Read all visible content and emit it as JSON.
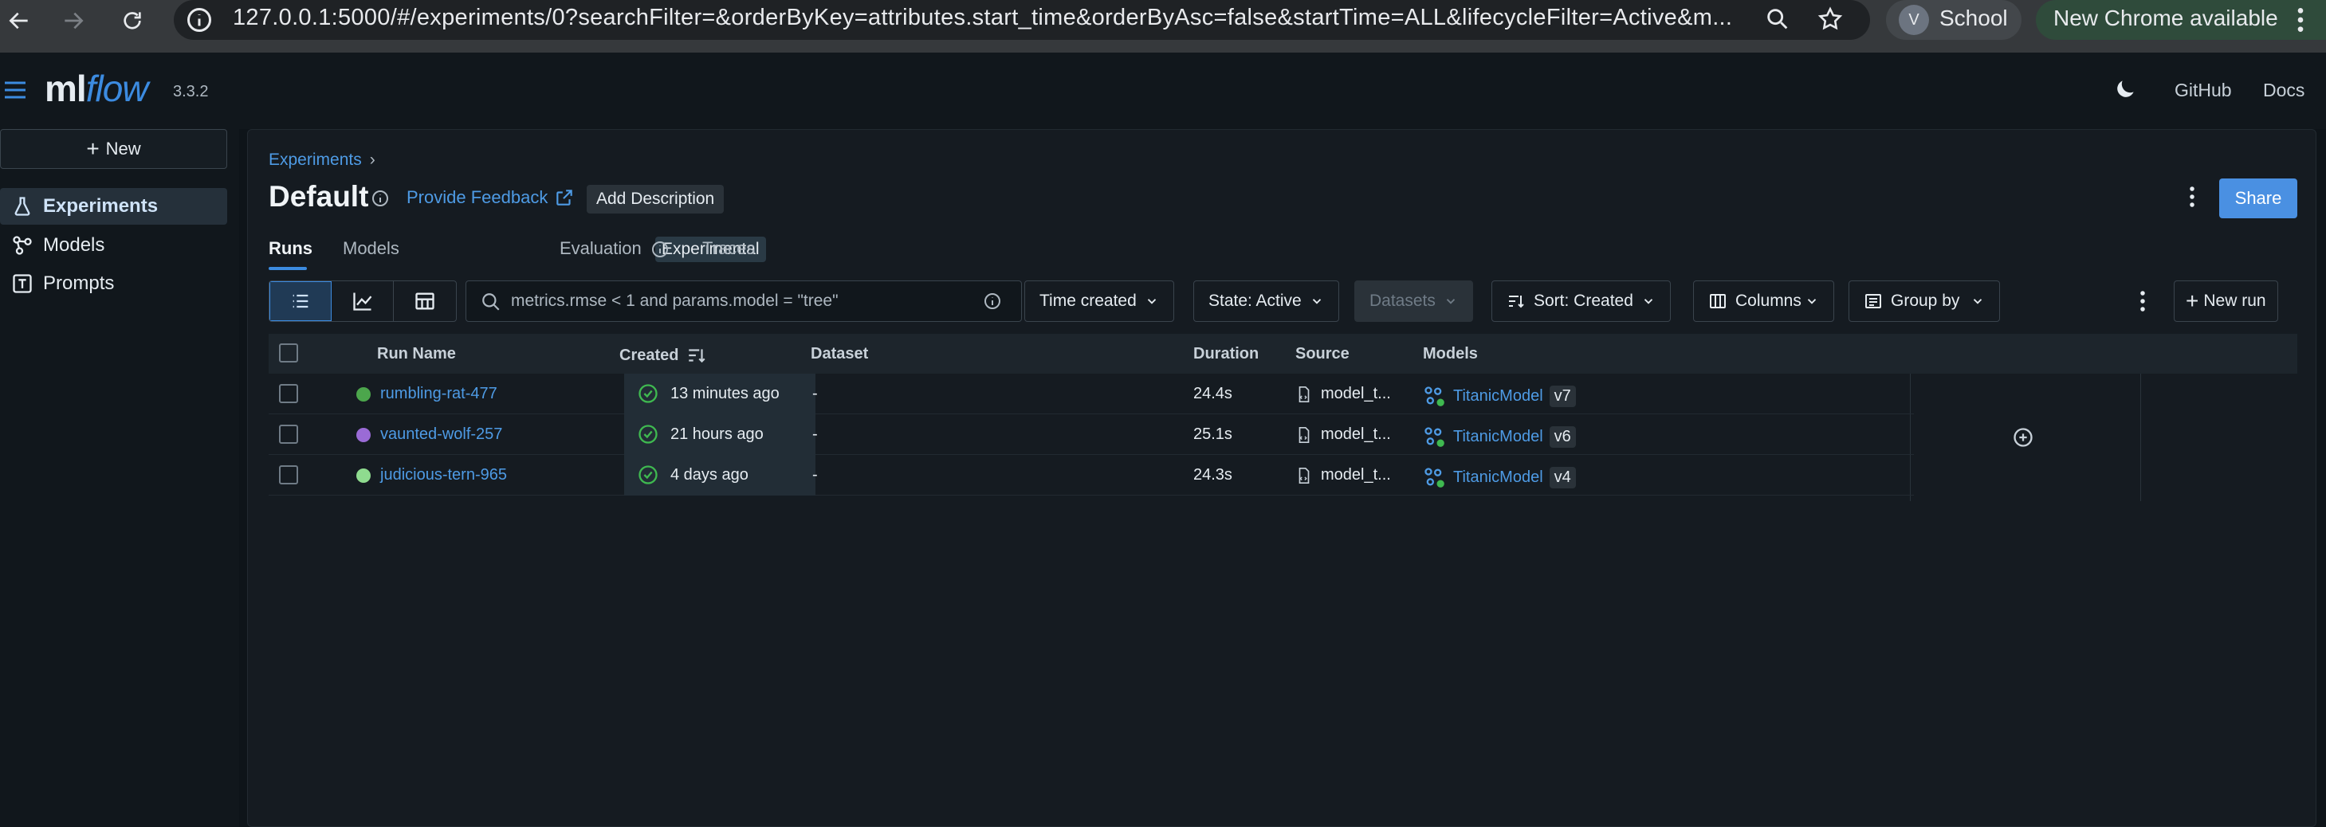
{
  "browser": {
    "url_main": "127.0.0.1:5000/#/experiments/0?searchFilter=&orderByKey=attributes.start_time&orderByAsc=false&startTime=ALL&lifecycleFilter=Active&m...",
    "profile_initial": "V",
    "profile_name": "School",
    "update_label": "New Chrome available"
  },
  "header": {
    "logo_ml": "ml",
    "logo_flow": "flow",
    "version": "3.3.2",
    "links": [
      "GitHub",
      "Docs"
    ]
  },
  "sidebar": {
    "new_label": "New",
    "items": [
      {
        "label": "Experiments",
        "icon": "beaker-icon",
        "active": true
      },
      {
        "label": "Models",
        "icon": "models-icon",
        "active": false
      },
      {
        "label": "Prompts",
        "icon": "prompts-icon",
        "active": false
      }
    ]
  },
  "page": {
    "breadcrumb": "Experiments",
    "title": "Default",
    "feedback_label": "Provide Feedback",
    "add_description_label": "Add Description",
    "share_label": "Share"
  },
  "tabs": [
    {
      "label": "Runs",
      "active": true
    },
    {
      "label": "Models",
      "active": false
    },
    {
      "label": "Evaluation",
      "active": false
    },
    {
      "label": "Traces",
      "active": false
    }
  ],
  "experimental_badge": "Experimental",
  "toolbar": {
    "search_placeholder": "metrics.rmse < 1 and params.model = \"tree\"",
    "time_created": "Time created",
    "state": "State: Active",
    "datasets": "Datasets",
    "sort": "Sort: Created",
    "columns": "Columns",
    "group_by": "Group by",
    "new_run": "New run"
  },
  "table": {
    "headers": [
      "Run Name",
      "Created",
      "Dataset",
      "Duration",
      "Source",
      "Models"
    ],
    "rows": [
      {
        "name": "rumbling-rat-477",
        "dot_color": "#4ca64c",
        "created": "13 minutes ago",
        "dataset": "-",
        "duration": "24.4s",
        "source": "model_t...",
        "model": "TitanicModel",
        "version": "v7"
      },
      {
        "name": "vaunted-wolf-257",
        "dot_color": "#9a6bd6",
        "created": "21 hours ago",
        "dataset": "-",
        "duration": "25.1s",
        "source": "model_t...",
        "model": "TitanicModel",
        "version": "v6"
      },
      {
        "name": "judicious-tern-965",
        "dot_color": "#8fdb8f",
        "created": "4 days ago",
        "dataset": "-",
        "duration": "24.3s",
        "source": "model_t...",
        "model": "TitanicModel",
        "version": "v4"
      }
    ]
  },
  "colors": {
    "accent": "#3c8be0",
    "link": "#4e9be5",
    "share_button": "#4a90e2",
    "success": "#3fb950"
  }
}
